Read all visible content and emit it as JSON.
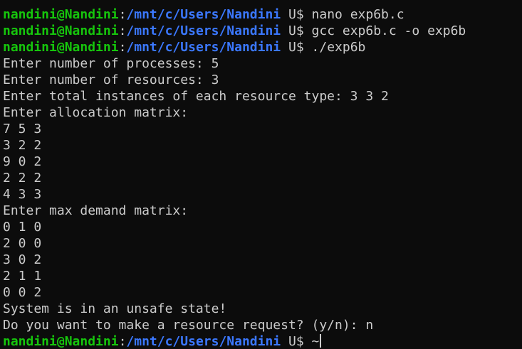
{
  "prompt": {
    "user_host": "nandini@Nandini",
    "separator": ":",
    "path": "/mnt/c/Users/Nandini",
    "symbol": " U$ "
  },
  "commands": [
    "nano exp6b.c",
    "gcc exp6b.c -o exp6b",
    "./exp6b"
  ],
  "output": [
    "Enter number of processes: 5",
    "Enter number of resources: 3",
    "Enter total instances of each resource type: 3 3 2",
    "Enter allocation matrix:",
    "7 5 3",
    "3 2 2",
    "9 0 2",
    "2 2 2",
    "4 3 3",
    "Enter max demand matrix:",
    "0 1 0",
    "2 0 0",
    "3 0 2",
    "2 1 1",
    "0 0 2",
    "System is in an unsafe state!",
    "Do you want to make a resource request? (y/n): n"
  ],
  "final_input": "~",
  "colors": {
    "background": "#0c0c0c",
    "text": "#cccccc",
    "user_host": "#16c60c",
    "path": "#3b78ff"
  }
}
